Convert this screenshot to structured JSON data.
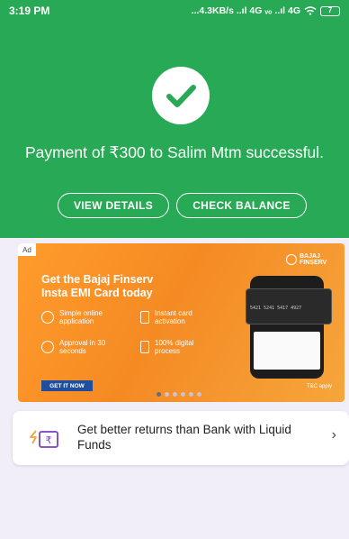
{
  "status_bar": {
    "time": "3:19 PM",
    "network": "...4.3KB/s ..ıl 4G ᵥₒ ..ıl 4G",
    "battery": "7"
  },
  "payment": {
    "message": "Payment of ₹300 to Salim Mtm successful.",
    "view_details_label": "VIEW DETAILS",
    "check_balance_label": "CHECK BALANCE"
  },
  "ad_banner": {
    "ad_label": "Ad",
    "brand": "BAJAJ FINSERV",
    "title": "Get the Bajaj Finserv Insta EMI Card today",
    "features": [
      {
        "text": "Simple online application",
        "icon": "fingerprint-icon"
      },
      {
        "text": "Instant card activation",
        "icon": "phone-icon"
      },
      {
        "text": "Approval in 30 seconds",
        "icon": "clock-icon"
      },
      {
        "text": "100% digital process",
        "icon": "tap-phone-icon"
      }
    ],
    "cta_label": "GET IT NOW",
    "terms": "T&C apply",
    "card_number": "5421 5241 5417 4927",
    "carousel": {
      "total": 6,
      "active": 0
    }
  },
  "funds_card": {
    "text": "Get better returns than Bank with Liquid Funds",
    "icon": "rupee-card-icon"
  },
  "colors": {
    "primary_green": "#27a955",
    "banner_orange": "#f58a23",
    "cta_blue": "#1f4f9c",
    "accent_purple": "#7b3fc4"
  }
}
